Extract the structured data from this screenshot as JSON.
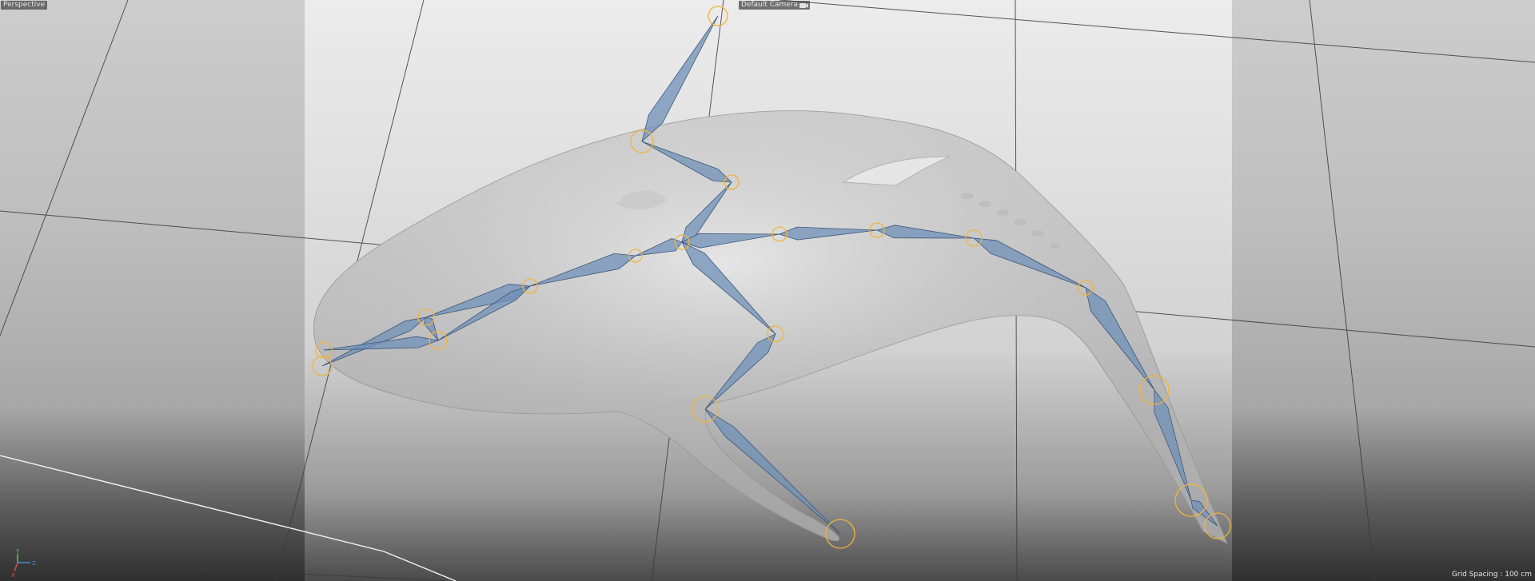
{
  "viewport": {
    "name": "Perspective",
    "camera": "Default Camera",
    "camera_icon": "camera-icon",
    "grid_spacing": "Grid Spacing : 100 cm"
  },
  "axis_gizmo": {
    "y_label": "Y",
    "z_label": "Z",
    "x_label": "X",
    "colors": {
      "x": "#d94a4a",
      "y": "#5fc35f",
      "z": "#4a8ad9"
    }
  },
  "colors": {
    "joint_ring": "#f0b43c",
    "bone_fill": "#6f90b8",
    "bone_edge": "#3d5677",
    "whale_body": "#d6d6d6"
  }
}
